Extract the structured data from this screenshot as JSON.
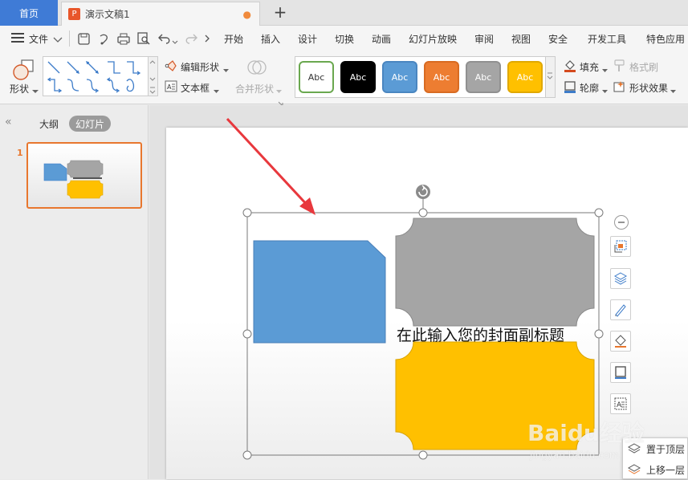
{
  "tabs": {
    "home": "首页",
    "document": "演示文稿1",
    "document_icon": "P",
    "unsaved_dot": "●",
    "add": "+"
  },
  "menu": {
    "file": "文件",
    "items": [
      "开始",
      "插入",
      "设计",
      "切换",
      "动画",
      "幻灯片放映",
      "审阅",
      "视图",
      "安全",
      "开发工具",
      "特色应用"
    ]
  },
  "ribbon": {
    "shape": "形状",
    "edit_shape": "编辑形状",
    "text_box": "文本框",
    "merge_shape": "合并形状",
    "fill": "填充",
    "format_painter": "格式刷",
    "outline": "轮廓",
    "shape_effect": "形状效果",
    "style_label": "Abc",
    "styles": [
      {
        "bg": "#ffffff",
        "fg": "#333333",
        "border": "#6aa84f"
      },
      {
        "bg": "#000000",
        "fg": "#ffffff",
        "border": "#000000"
      },
      {
        "bg": "#5b9bd5",
        "fg": "#ffffff",
        "border": "#4a86c0"
      },
      {
        "bg": "#ed7d31",
        "fg": "#ffffff",
        "border": "#d86b22"
      },
      {
        "bg": "#a5a5a5",
        "fg": "#ffffff",
        "border": "#909090"
      },
      {
        "bg": "#ffc000",
        "fg": "#ffffff",
        "border": "#e0a800"
      }
    ]
  },
  "panel": {
    "outline_tab": "大纲",
    "slides_tab": "幻灯片",
    "slide_number": "1",
    "collapse": "«"
  },
  "slide": {
    "subtitle_placeholder": "在此输入您的封面副标题"
  },
  "context_menu": {
    "bring_to_front": "置于顶层",
    "bring_forward": "上移一层"
  },
  "watermark": {
    "brand": "Baidu经验",
    "url": "jingyan.baidu.com"
  },
  "colors": {
    "accent": "#3f7bd6",
    "blue_shape": "#5b9bd5",
    "gray_shape": "#a5a5a5",
    "gold_shape": "#ffc000",
    "arrow": "#e8383d",
    "thumb_border": "#e8772e"
  }
}
